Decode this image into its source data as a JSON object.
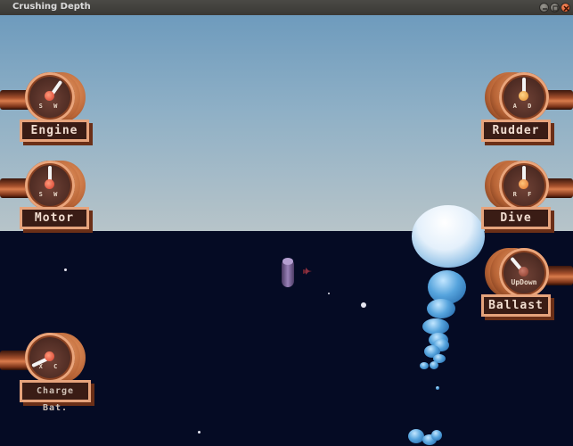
{
  "window": {
    "title": "Crushing Depth"
  },
  "window_controls": [
    "minimize",
    "maximize",
    "close"
  ],
  "gauges_left": [
    {
      "label": "Engine",
      "keys": "S W"
    },
    {
      "label": "Motor",
      "keys": "S W"
    },
    {
      "label": "Charge Bat.",
      "keys": "X C"
    }
  ],
  "gauges_right": [
    {
      "label": "Rudder",
      "keys": "A D"
    },
    {
      "label": "Dive",
      "keys": "R F"
    },
    {
      "label": "Ballast",
      "keys": "UpDown"
    }
  ],
  "colors": {
    "sky": "#8fb0c6",
    "sea": "#050b24",
    "copper": "#d97b4c",
    "bubble": "#56a4dd",
    "plate_bg": "#3a1c15",
    "plate_border": "#e6a37c"
  }
}
